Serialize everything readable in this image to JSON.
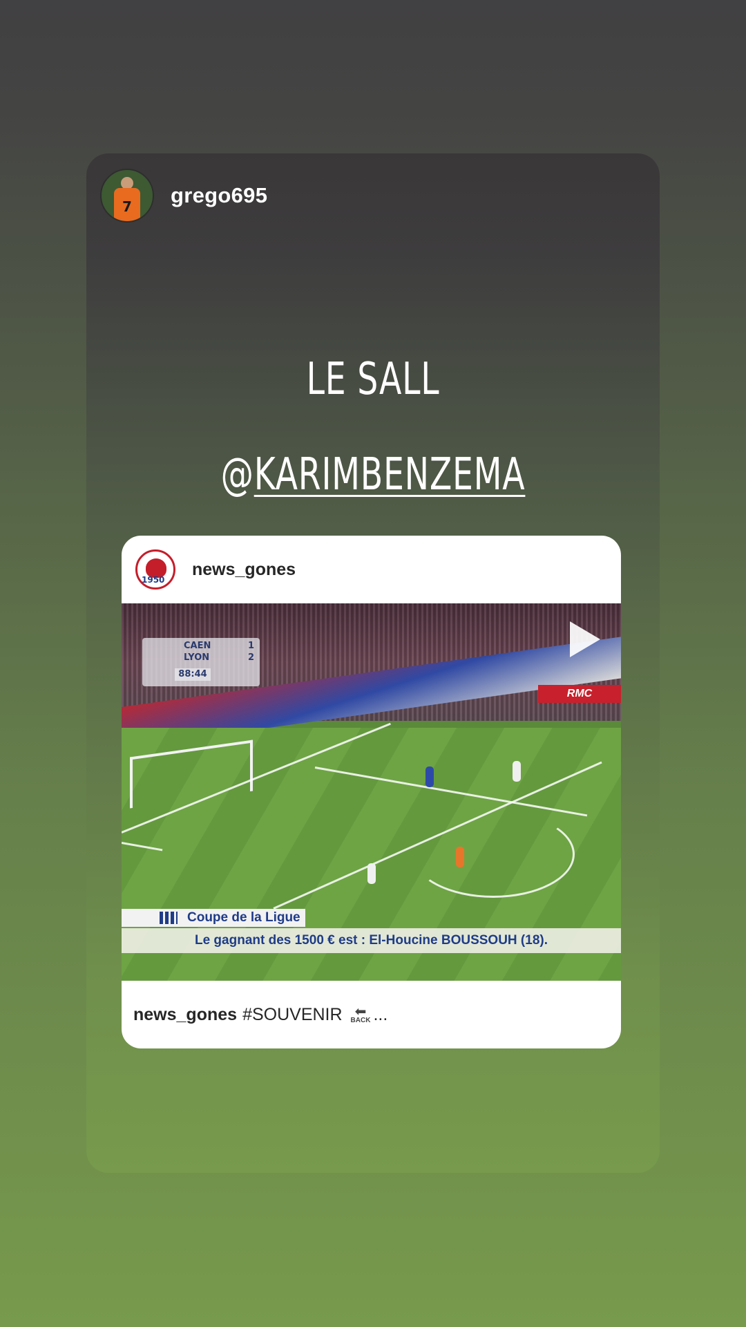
{
  "story": {
    "username": "grego695",
    "avatar_jersey_number": "7",
    "text_line1": "LE SALL",
    "mention_at": "@",
    "mention_handle": "KARIMBENZEMA"
  },
  "shared_post": {
    "username": "news_gones",
    "logo_year": "1950",
    "video": {
      "scoreboard_team1": "CAEN",
      "scoreboard_score1": "1",
      "scoreboard_team2": "LYON",
      "scoreboard_score2": "2",
      "scoreboard_clock": "88:44",
      "ad_board": "RMC",
      "lower_third_title": "Coupe de la Ligue",
      "lower_third_text": "Le gagnant des 1500 € est : El-Houcine BOUSSOUH (18)."
    },
    "caption_username": "news_gones",
    "caption_text": "#SOUVENIR",
    "caption_back_arrow": "⬅",
    "caption_back_label": "BACK",
    "caption_ellipsis": "..."
  },
  "icons": {
    "play": "play-icon",
    "back": "back-arrow-icon"
  }
}
